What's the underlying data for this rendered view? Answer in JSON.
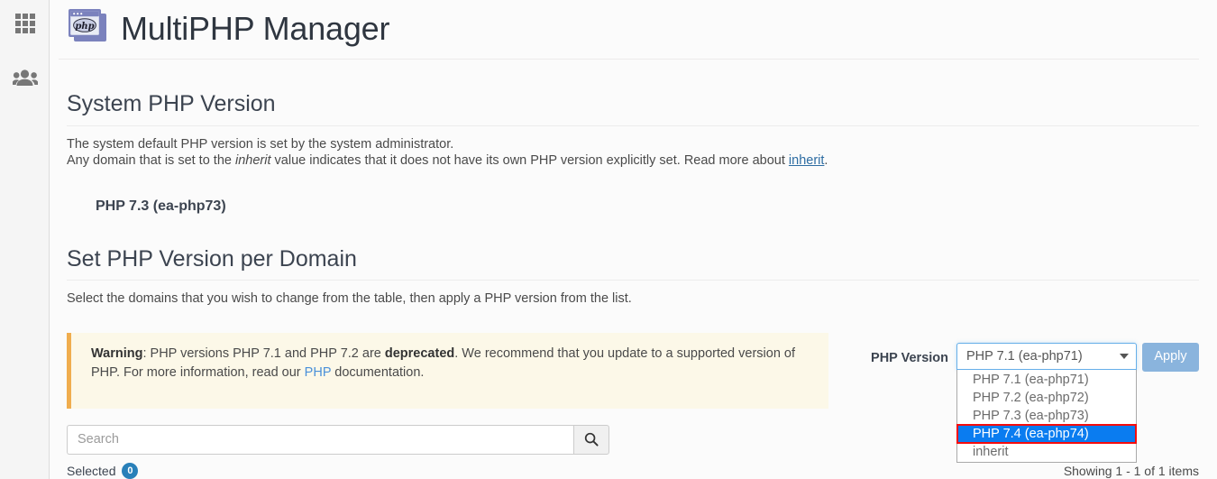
{
  "sidebar": {
    "items": [
      {
        "name": "apps-grid",
        "icon": "grid-icon"
      },
      {
        "name": "users",
        "icon": "people-icon"
      }
    ]
  },
  "header": {
    "title": "MultiPHP Manager",
    "logo_text": "php",
    "logo_icon": "php-window-icon"
  },
  "system_section": {
    "title": "System PHP Version",
    "line1": "The system default PHP version is set by the system administrator.",
    "line2_a": "Any domain that is set to the ",
    "line2_italic": "inherit",
    "line2_b": " value indicates that it does not have its own PHP version explicitly set. Read more about ",
    "line2_link": "inherit",
    "line2_c": ".",
    "current_version": "PHP 7.3 (ea-php73)"
  },
  "domain_section": {
    "title": "Set PHP Version per Domain",
    "description": "Select the domains that you wish to change from the table, then apply a PHP version from the list."
  },
  "warning": {
    "label": "Warning",
    "text_a": ": PHP versions PHP 7.1 and PHP 7.2 are ",
    "bold": "deprecated",
    "text_b": ". We recommend that you update to a supported version of PHP. For more information, read our ",
    "link": "PHP",
    "text_c": " documentation.",
    "border_color": "#f0ad4e",
    "background_color": "#fcf8e8"
  },
  "php_version_control": {
    "label": "PHP Version",
    "selected_value": "PHP 7.1 (ea-php71)",
    "apply_label": "Apply",
    "apply_color": "#8ab4dd",
    "highlight_color": "#0a7cf0",
    "highlight_outline_color": "#f60c0c",
    "options": [
      "PHP 7.1 (ea-php71)",
      "PHP 7.2 (ea-php72)",
      "PHP 7.3 (ea-php73)",
      "PHP 7.4 (ea-php74)",
      "inherit"
    ],
    "highlighted_option": "PHP 7.4 (ea-php74)",
    "highlighted_index": 3
  },
  "search": {
    "placeholder": "Search",
    "value": "",
    "icon": "search-icon"
  },
  "footer": {
    "selected_label": "Selected",
    "selected_count": "0",
    "badge_color": "#2980b9",
    "showing_text": "Showing 1 - 1 of 1 items"
  }
}
